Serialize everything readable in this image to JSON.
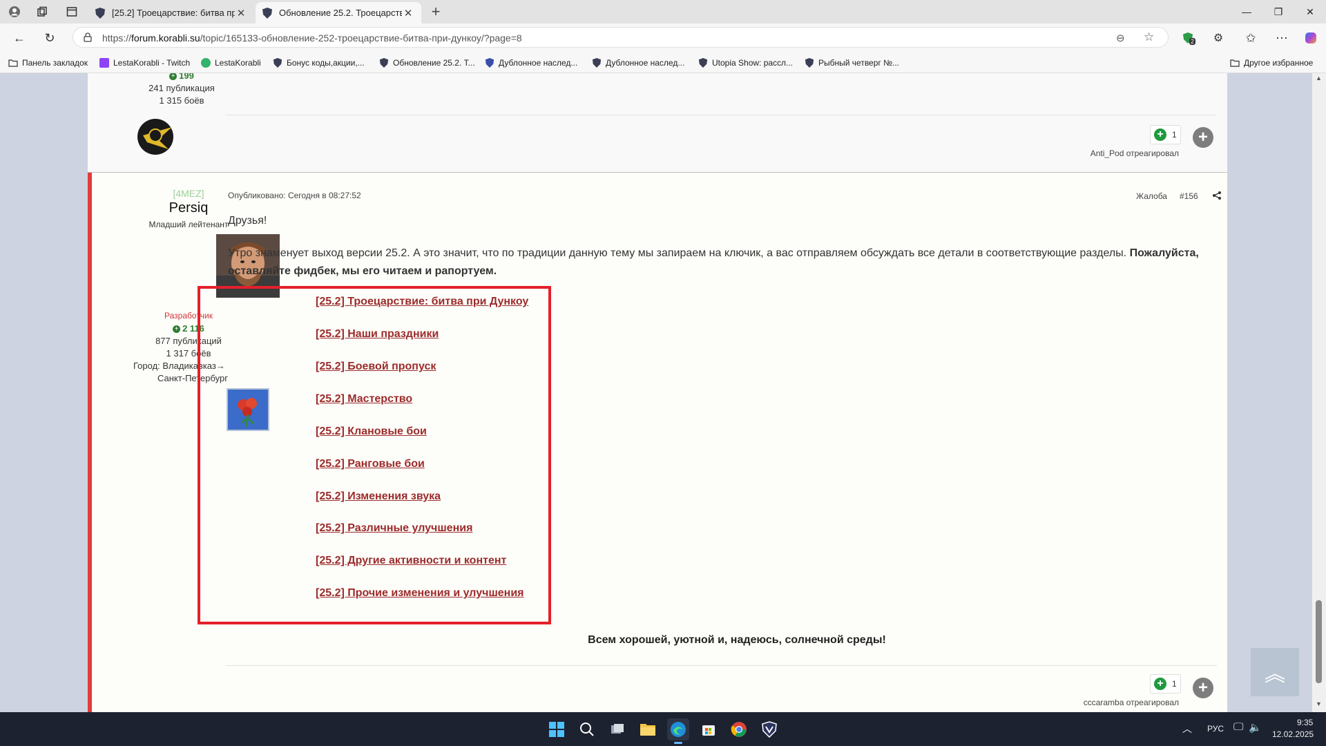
{
  "browser": {
    "tabs": [
      {
        "title": "[25.2] Троецарствие: битва при Д",
        "active": false
      },
      {
        "title": "Обновление 25.2. Троецарствие",
        "active": true
      }
    ],
    "url_prefix": "https://",
    "url_domain": "forum.korabli.su",
    "url_path": "/topic/165133-обновление-252-троецарствие-битва-при-дункоу/?page=8",
    "extension_badge": "2",
    "bookmarks": [
      {
        "label": "Панель закладок"
      },
      {
        "label": "LestaKorabli - Twitch"
      },
      {
        "label": "LestaKorabli"
      },
      {
        "label": "Бонус коды,акции,..."
      },
      {
        "label": "Обновление 25.2. Т..."
      },
      {
        "label": "Дублонное наслед..."
      },
      {
        "label": "Дублонное наслед..."
      },
      {
        "label": "Utopia Show: рассл..."
      },
      {
        "label": "Рыбный четверг №..."
      }
    ],
    "other_bookmarks": "Другое избранное"
  },
  "post_prev": {
    "rep": "199",
    "posts": "241 публикация",
    "battles": "1 315 боёв",
    "reaction_count": "1",
    "reacted_by": "Anti_Pod отреагировал"
  },
  "post": {
    "clan": "[4MEZ]",
    "author": "Persiq",
    "rank": "Младший лейтенант",
    "role": "Разработчик",
    "rep": "2 116",
    "posts": "877 публикаций",
    "battles": "1 317 боёв",
    "city_line1": "Город: Владикавказ→",
    "city_line2": "Санкт-Петербург",
    "published": "Опубликовано: Сегодня в 08:27:52",
    "report": "Жалоба",
    "number": "#156",
    "greeting": "Друзья!",
    "intro": "Утро знаменует выход версии 25.2. А это значит, что по традиции данную тему мы запираем на ключик, а вас отправляем обсуждать все детали в соответствующие разделы.",
    "intro_bold": "Пожалуйста, оставляйте фидбек, мы его читаем и рапортуем.",
    "links": [
      "[25.2] Троецарствие: битва при Дункоу",
      "[25.2] Наши праздники",
      "[25.2] Боевой пропуск",
      "[25.2] Мастерство",
      "[25.2] Клановые бои",
      "[25.2] Ранговые бои",
      "[25.2] Изменения звука",
      "[25.2] Различные улучшения",
      "[25.2] Другие активности и контент",
      "[25.2] Прочие изменения и улучшения"
    ],
    "closing": "Всем хорошей, уютной и, надеюсь, солнечной среды!",
    "reaction_count": "1",
    "reacted_by": "cccaramba отреагировал"
  },
  "taskbar": {
    "lang": "РУС",
    "time": "9:35",
    "date": "12.02.2025"
  },
  "colors": {
    "accent_red": "#e33b3b",
    "link": "#9b2b2b",
    "rep_green": "#2e7d32"
  }
}
